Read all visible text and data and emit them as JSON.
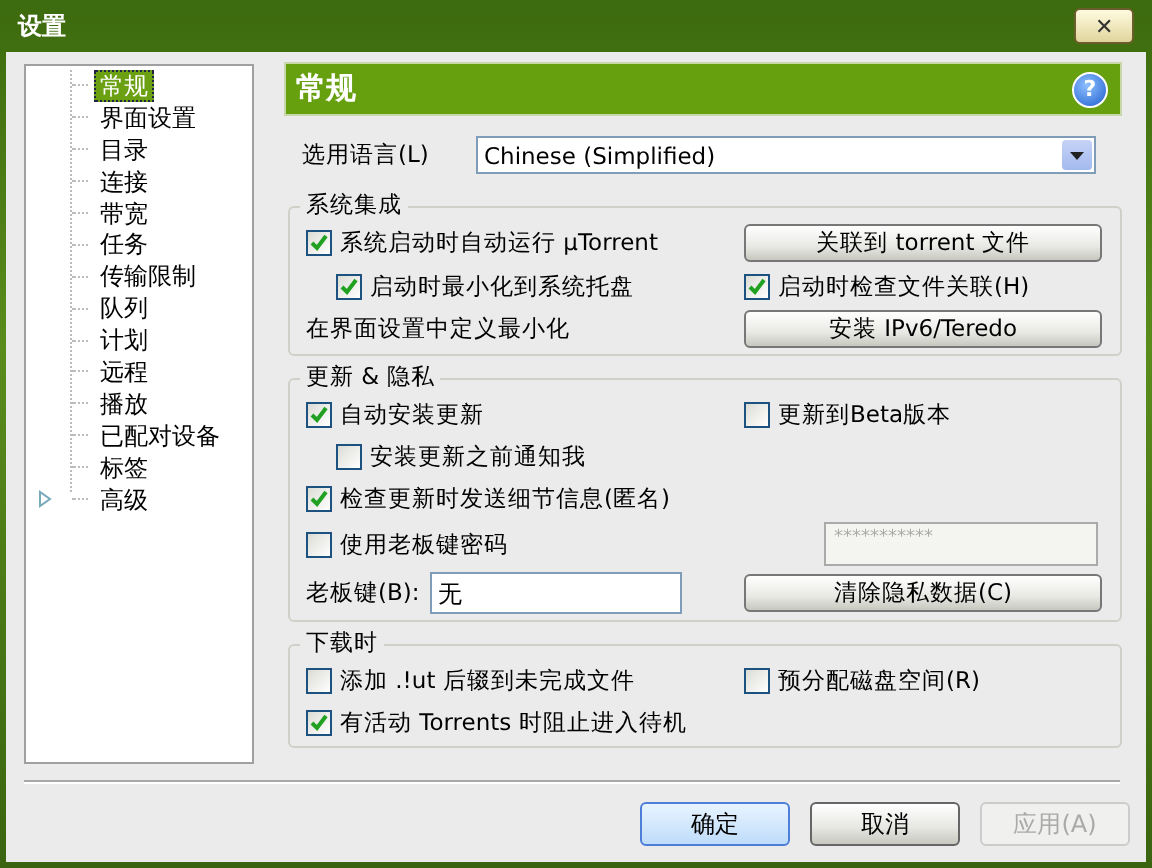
{
  "window": {
    "title": "设置",
    "close": "✕"
  },
  "sidebar": {
    "items": [
      {
        "label": "常规",
        "selected": true
      },
      {
        "label": "界面设置",
        "selected": false
      },
      {
        "label": "目录",
        "selected": false
      },
      {
        "label": "连接",
        "selected": false
      },
      {
        "label": "带宽",
        "selected": false
      },
      {
        "label": "任务",
        "selected": false
      },
      {
        "label": "传输限制",
        "selected": false
      },
      {
        "label": "队列",
        "selected": false
      },
      {
        "label": "计划",
        "selected": false
      },
      {
        "label": "远程",
        "selected": false
      },
      {
        "label": "播放",
        "selected": false
      },
      {
        "label": "已配对设备",
        "selected": false
      },
      {
        "label": "标签",
        "selected": false
      },
      {
        "label": "高级",
        "selected": false,
        "expanded": false
      }
    ]
  },
  "panel": {
    "title": "常规",
    "help": "?",
    "language": {
      "label": "选用语言(L)",
      "value": "Chinese (Simplified)"
    },
    "groups": [
      {
        "title": "系统集成",
        "rows": [
          [
            {
              "kind": "checkbox",
              "label": "系统启动时自动运行 µTorrent",
              "checked": true
            },
            {
              "kind": "button",
              "label": "关联到 torrent 文件"
            }
          ],
          [
            {
              "kind": "sub_checkbox",
              "label": "启动时最小化到系统托盘",
              "checked": true
            },
            {
              "kind": "checkbox",
              "label": "启动时检查文件关联(H)",
              "checked": true
            }
          ],
          [
            {
              "kind": "text",
              "label": "在界面设置中定义最小化"
            },
            {
              "kind": "button",
              "label": "安装 IPv6/Teredo"
            }
          ]
        ]
      },
      {
        "title": "更新 & 隐私",
        "rows": [
          [
            {
              "kind": "checkbox",
              "label": "自动安装更新",
              "checked": true
            },
            {
              "kind": "checkbox",
              "label": "更新到Beta版本",
              "checked": false
            }
          ],
          [
            {
              "kind": "sub_checkbox",
              "label": "安装更新之前通知我",
              "checked": false
            }
          ],
          [
            {
              "kind": "checkbox",
              "label": "检查更新时发送细节信息(匿名)",
              "checked": true
            }
          ],
          [
            {
              "kind": "checkbox",
              "label": "使用老板键密码",
              "checked": false
            },
            {
              "kind": "password",
              "value": "***********",
              "disabled": true
            }
          ],
          [
            {
              "kind": "field",
              "label": "老板键(B):",
              "value": "无"
            },
            {
              "kind": "button",
              "label": "清除隐私数据(C)"
            }
          ]
        ]
      },
      {
        "title": "下载时",
        "rows": [
          [
            {
              "kind": "checkbox",
              "label": "添加 .!ut 后辍到未完成文件",
              "checked": false
            },
            {
              "kind": "checkbox",
              "label": "预分配磁盘空间(R)",
              "checked": false
            }
          ],
          [
            {
              "kind": "checkbox",
              "label": "有活动 Torrents 时阻止进入待机",
              "checked": true
            }
          ]
        ]
      }
    ]
  },
  "buttons": [
    {
      "label": "确定",
      "default": true,
      "disabled": false
    },
    {
      "label": "取消",
      "default": false,
      "disabled": false
    },
    {
      "label": "应用(A)",
      "default": false,
      "disabled": true
    }
  ]
}
